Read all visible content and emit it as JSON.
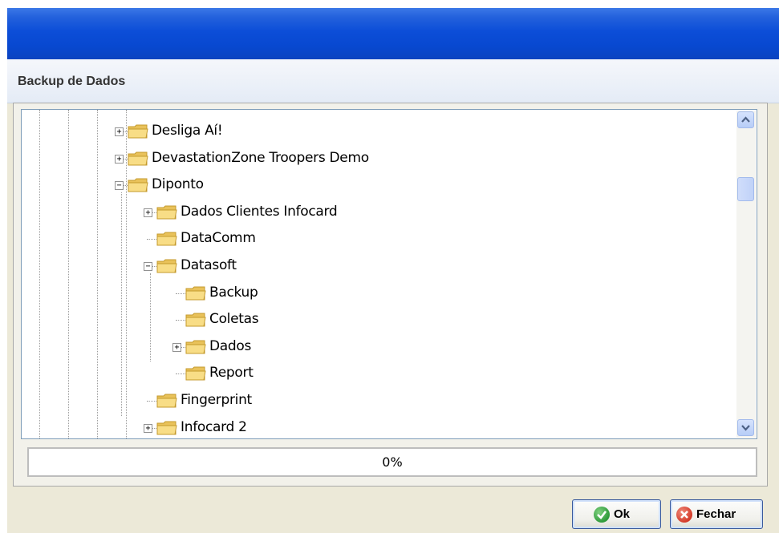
{
  "window": {
    "title": ""
  },
  "header": {
    "title": "Backup de Dados"
  },
  "tree": {
    "items": [
      {
        "label": "Desliga Aí!",
        "expander": "+",
        "depth": 0
      },
      {
        "label": "DevastationZone Troopers Demo",
        "expander": "+",
        "depth": 0
      },
      {
        "label": "Diponto",
        "expander": "−",
        "depth": 0
      },
      {
        "label": "Dados Clientes Infocard",
        "expander": "+",
        "depth": 1
      },
      {
        "label": "DataComm",
        "expander": "",
        "depth": 1
      },
      {
        "label": "Datasoft",
        "expander": "−",
        "depth": 1
      },
      {
        "label": "Backup",
        "expander": "",
        "depth": 2
      },
      {
        "label": "Coletas",
        "expander": "",
        "depth": 2
      },
      {
        "label": "Dados",
        "expander": "+",
        "depth": 2
      },
      {
        "label": "Report",
        "expander": "",
        "depth": 2
      },
      {
        "label": "Fingerprint",
        "expander": "",
        "depth": 1
      },
      {
        "label": "Infocard 2",
        "expander": "+",
        "depth": 1
      }
    ]
  },
  "progress": {
    "text": "0%",
    "value": 0
  },
  "buttons": {
    "ok": "Ok",
    "close": "Fechar"
  },
  "colors": {
    "titlebar": "#0c4ed8",
    "folder": "#f5d77a",
    "ok_icon": "#2e9a3a",
    "close_icon": "#d43b2a"
  }
}
